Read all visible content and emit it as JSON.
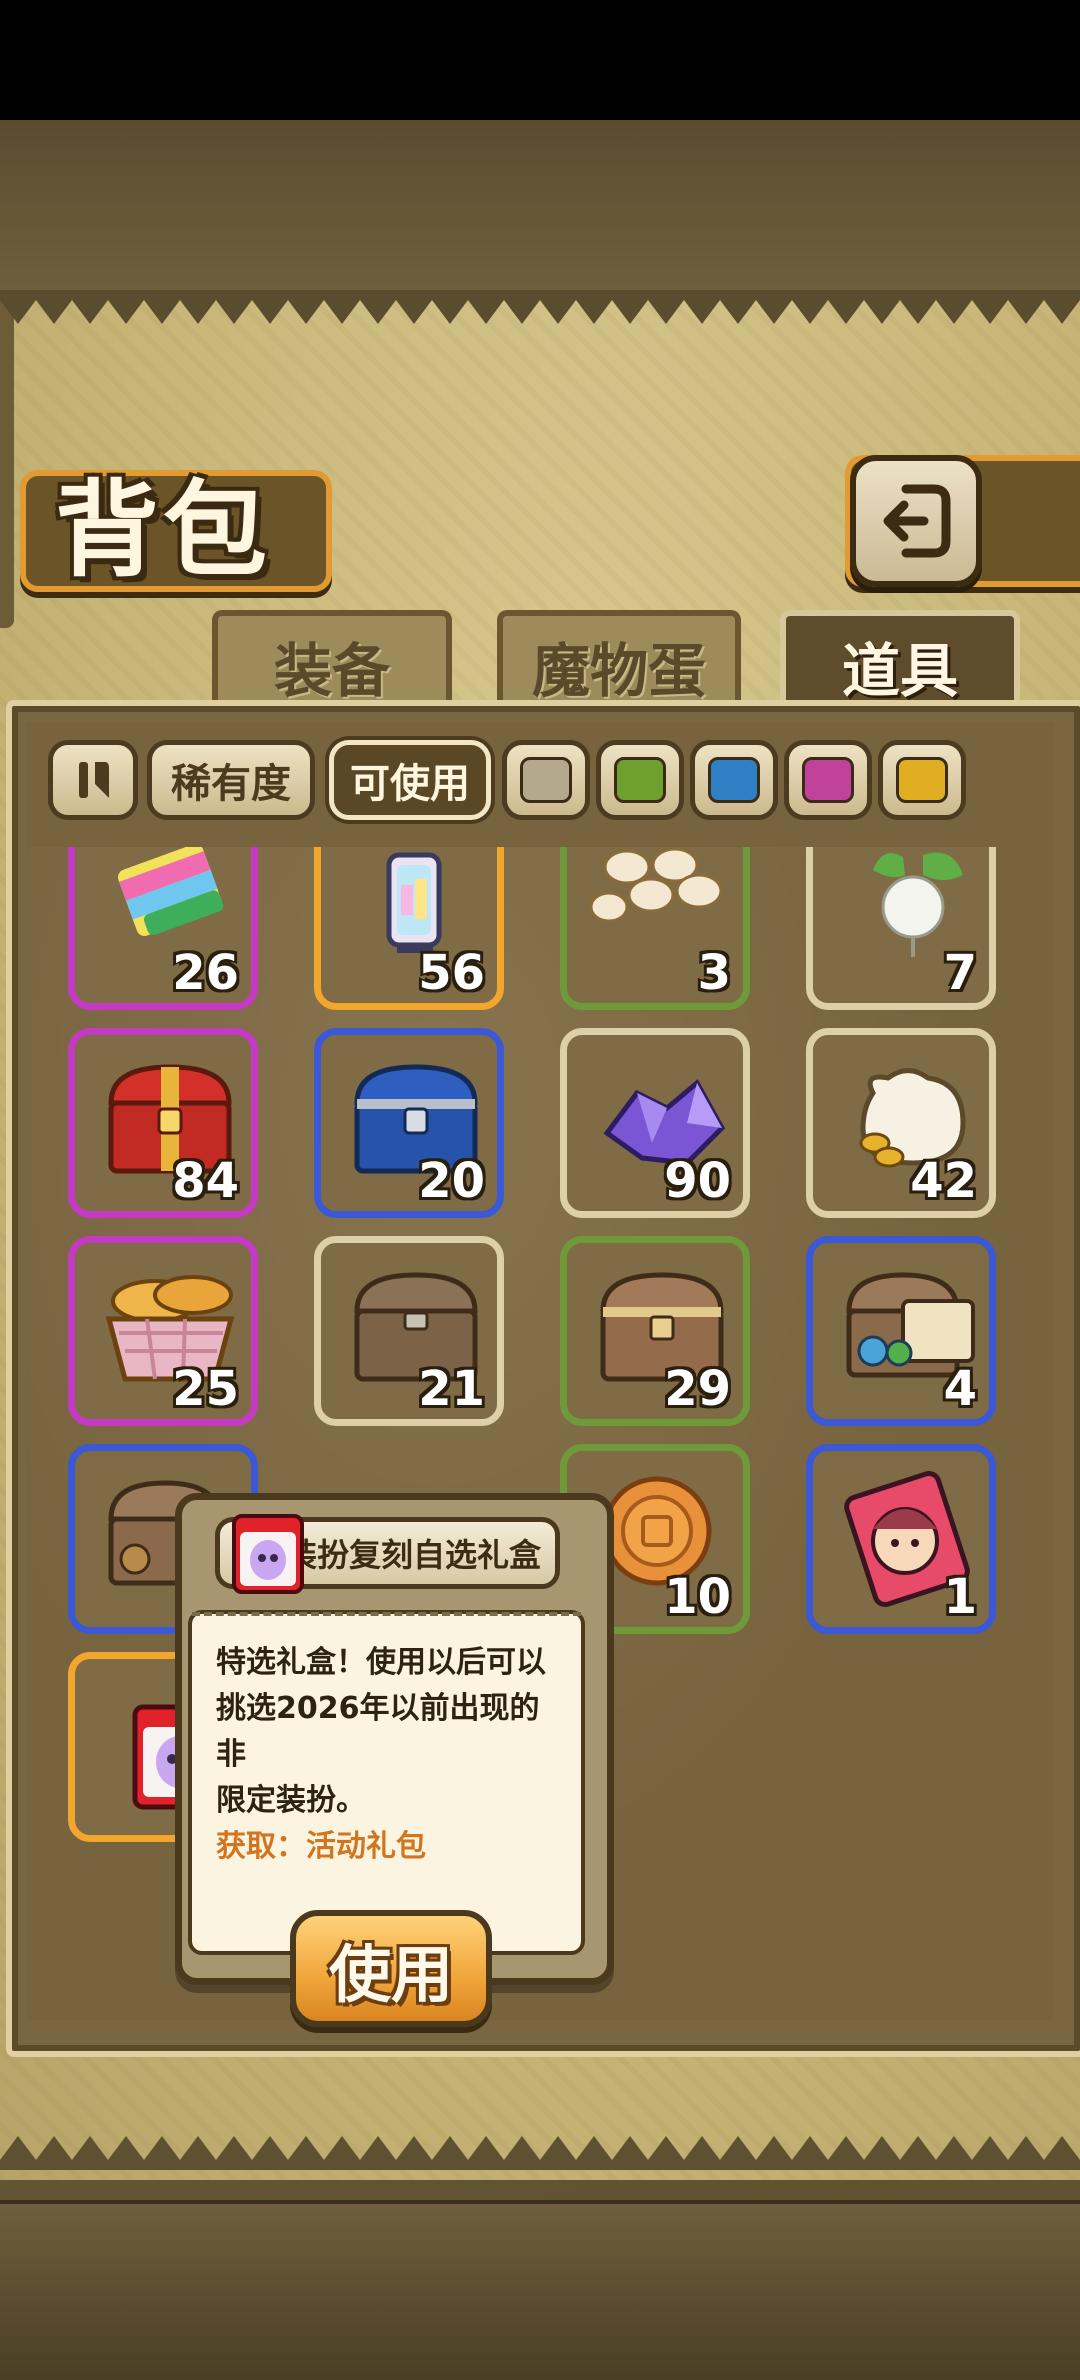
{
  "screen": {
    "title": "背包",
    "back_icon": "return-arrow-icon"
  },
  "tabs": [
    {
      "label": "装备",
      "active": false
    },
    {
      "label": "魔物蛋",
      "active": false
    },
    {
      "label": "道具",
      "active": true
    }
  ],
  "filters": {
    "sort_icon": "pause-sort-icon",
    "rarity_label": "稀有度",
    "usable_label": "可使用",
    "usable_selected": true,
    "rarity_colors": [
      "#b4a98c",
      "#6f9f2e",
      "#2f7fc4",
      "#c0429a",
      "#e1ad22"
    ]
  },
  "rarity_frame_colors": {
    "gray": "#ddd0a6",
    "green": "#6f9a3a",
    "blue": "#3b58d6",
    "purple": "#c43ac2",
    "gold": "#f2a62d"
  },
  "items": [
    {
      "name": "rainbow-book-icon",
      "count": "26",
      "rarity": "purple"
    },
    {
      "name": "crystal-lantern-icon",
      "count": "56",
      "rarity": "gold"
    },
    {
      "name": "eggs-pile-icon",
      "count": "3",
      "rarity": "green"
    },
    {
      "name": "turnip-icon",
      "count": "7",
      "rarity": "gray"
    },
    {
      "name": "red-chest-icon",
      "count": "84",
      "rarity": "purple"
    },
    {
      "name": "blue-chest-icon",
      "count": "20",
      "rarity": "blue"
    },
    {
      "name": "purple-crystal-icon",
      "count": "90",
      "rarity": "gray"
    },
    {
      "name": "coin-sack-icon",
      "count": "42",
      "rarity": "gray"
    },
    {
      "name": "bread-basket-icon",
      "count": "25",
      "rarity": "purple"
    },
    {
      "name": "wooden-chest-icon",
      "count": "21",
      "rarity": "gray"
    },
    {
      "name": "wooden-chest-icon",
      "count": "29",
      "rarity": "green"
    },
    {
      "name": "chest-map-icon",
      "count": "4",
      "rarity": "blue"
    },
    {
      "name": "chest-map-icon",
      "count": "",
      "rarity": "blue"
    },
    {
      "name": "mooncake-icon",
      "count": "10",
      "rarity": "green"
    },
    {
      "name": "character-card-icon",
      "count": "1",
      "rarity": "blue"
    },
    {
      "name": "costume-gift-box-icon",
      "count": "",
      "rarity": "gold"
    }
  ],
  "tooltip": {
    "item_name": "装扮复刻自选礼盒",
    "desc_line1": "特选礼盒！使用以后可以",
    "desc_line2": "挑选2026年以前出现的非",
    "desc_line3": "限定装扮。",
    "source": "获取：活动礼包",
    "use_label": "使用"
  }
}
